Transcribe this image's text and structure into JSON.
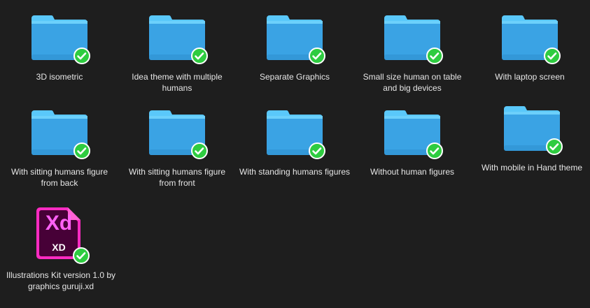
{
  "colors": {
    "background": "#1e1e1e",
    "folder_top": "#5ac8fa",
    "folder_body": "#3aa3e4",
    "badge_green": "#2ecc40",
    "xd_magenta": "#ff2bc2",
    "xd_dark": "#470137"
  },
  "items": [
    {
      "label": "3D isometric",
      "icon": "folder-icon"
    },
    {
      "label": "Idea theme with multiple humans",
      "icon": "folder-icon"
    },
    {
      "label": "Separate Graphics",
      "icon": "folder-icon"
    },
    {
      "label": "Small size human on table and big devices",
      "icon": "folder-icon"
    },
    {
      "label": "With laptop screen",
      "icon": "folder-icon"
    },
    {
      "label": "With sitting humans figure from back",
      "icon": "folder-icon"
    },
    {
      "label": "With sitting humans figure from front",
      "icon": "folder-icon"
    },
    {
      "label": "With standing humans figures",
      "icon": "folder-icon"
    },
    {
      "label": "Without human figures",
      "icon": "folder-icon"
    },
    {
      "label": "With mobile in Hand theme",
      "icon": "folder-icon"
    },
    {
      "label": "Illustrations Kit version 1.0 by graphics guruji.xd",
      "icon": "xd-file-icon",
      "logo_text": "Xd",
      "ext_text": "XD"
    }
  ]
}
